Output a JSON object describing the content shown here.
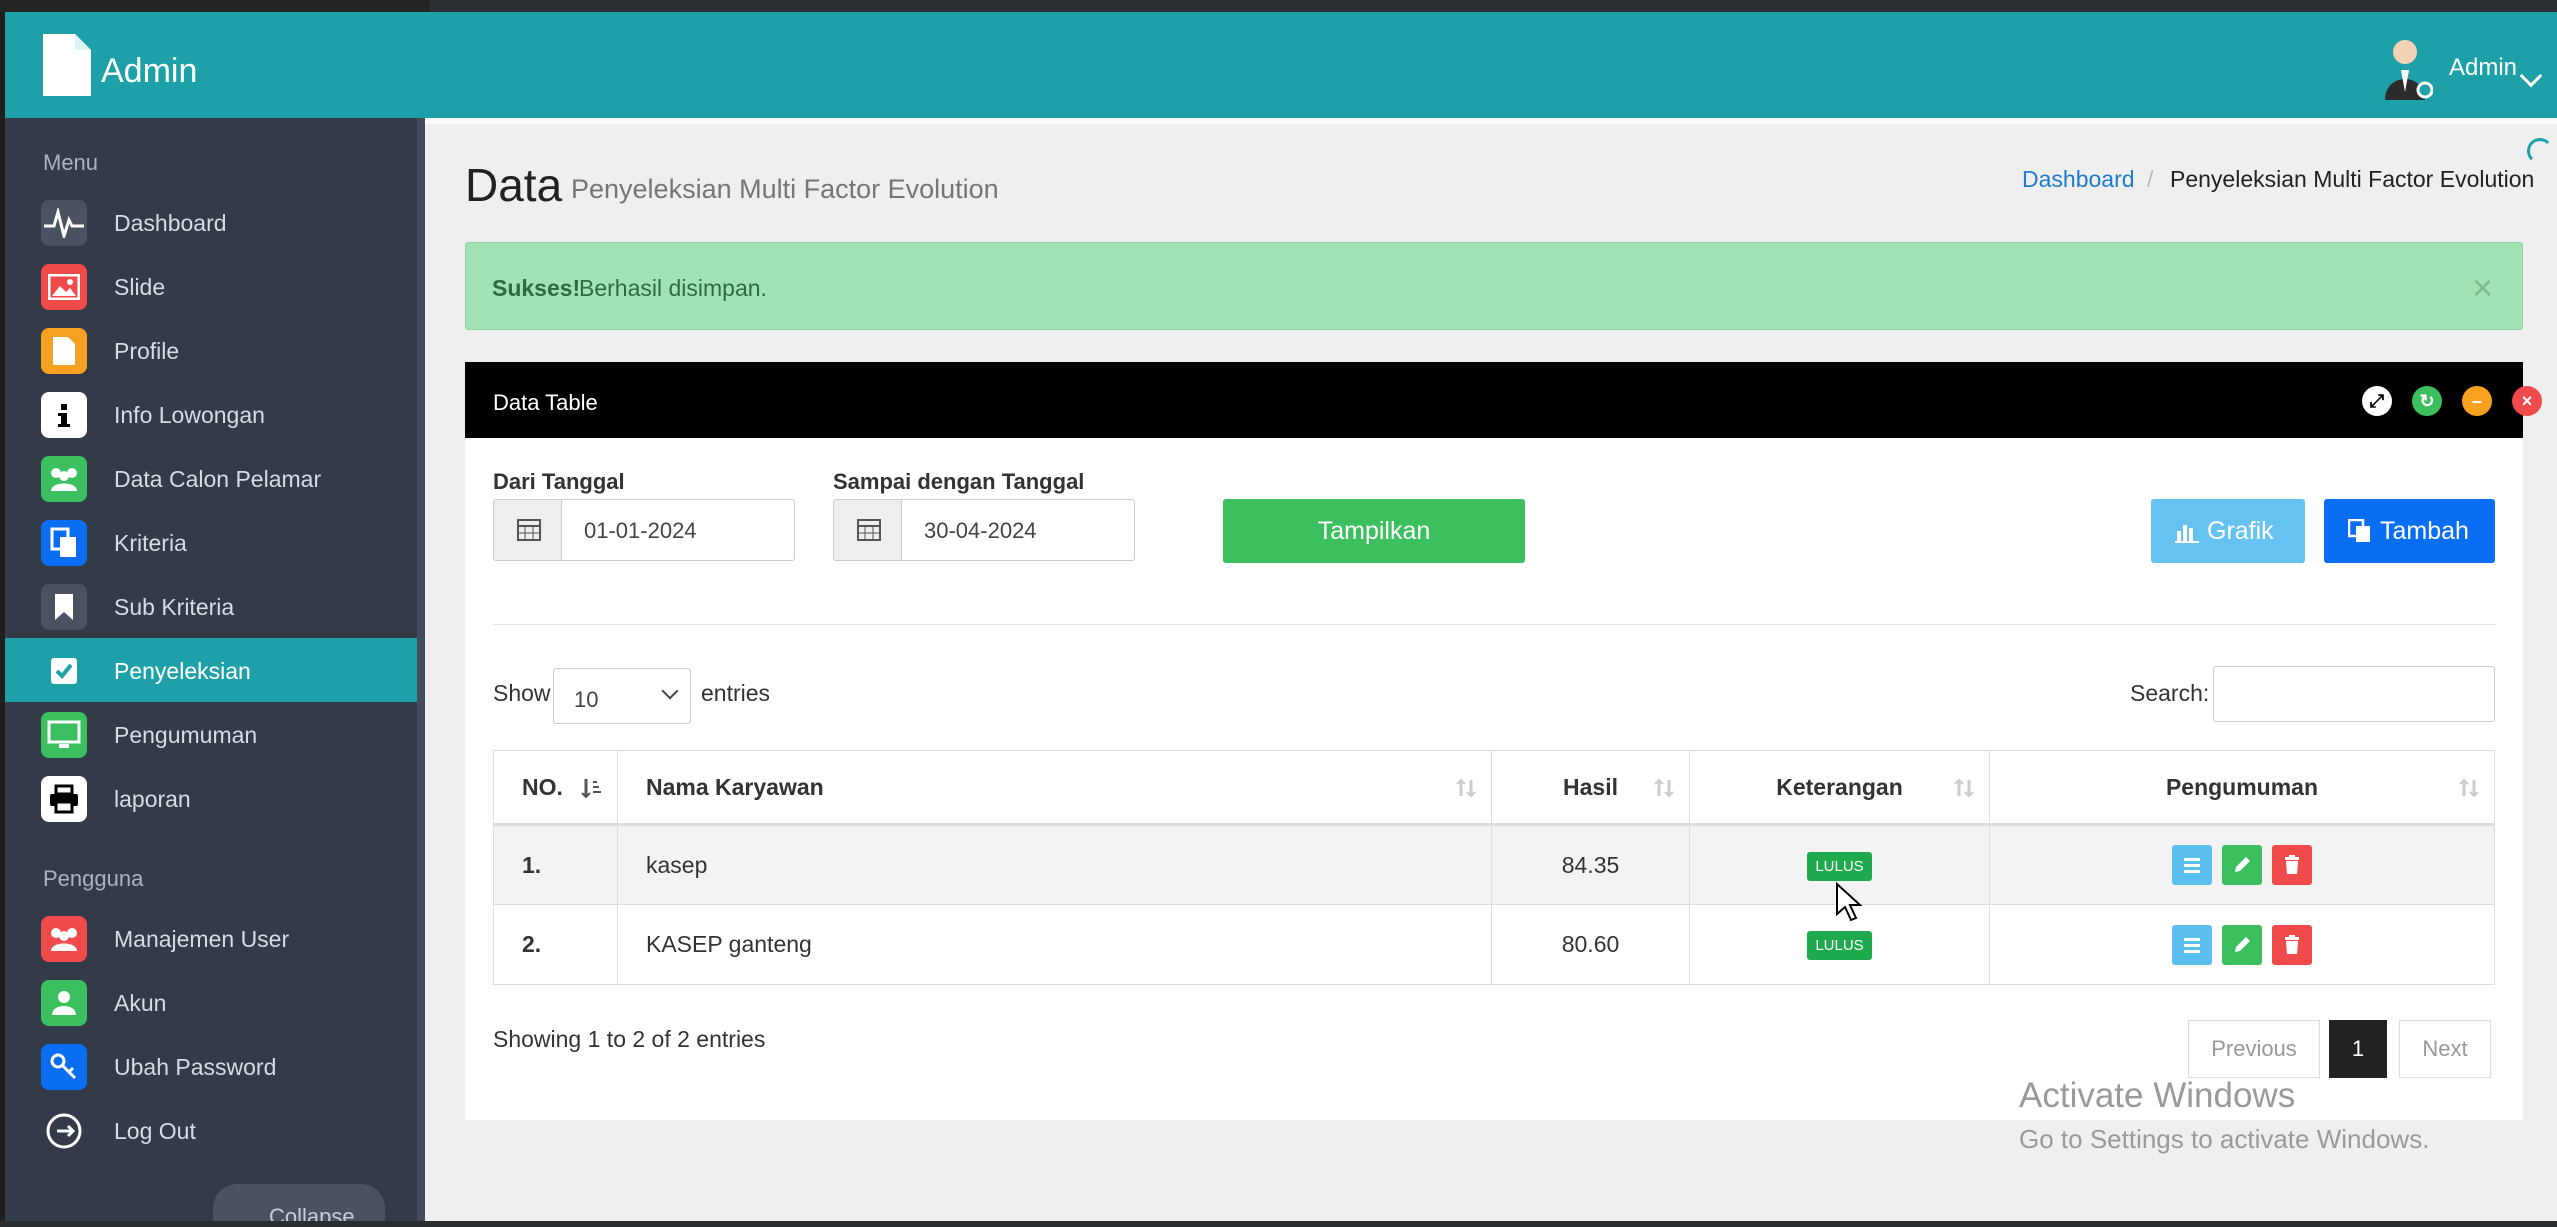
{
  "header": {
    "app_title": "Admin",
    "user_name": "Admin"
  },
  "sidebar": {
    "menu_heading": "Menu",
    "items": [
      {
        "label": "Dashboard",
        "icon": "pulse-icon"
      },
      {
        "label": "Slide",
        "icon": "image-icon"
      },
      {
        "label": "Profile",
        "icon": "document-icon"
      },
      {
        "label": "Info Lowongan",
        "icon": "info-icon"
      },
      {
        "label": "Data Calon Pelamar",
        "icon": "users-icon"
      },
      {
        "label": "Kriteria",
        "icon": "copy-icon"
      },
      {
        "label": "Sub Kriteria",
        "icon": "bookmark-icon"
      },
      {
        "label": "Penyeleksian",
        "icon": "checkbox-icon"
      },
      {
        "label": "Pengumuman",
        "icon": "monitor-icon"
      },
      {
        "label": "laporan",
        "icon": "printer-icon"
      }
    ],
    "pengguna_heading": "Pengguna",
    "user_items": [
      {
        "label": "Manajemen User",
        "icon": "users-icon"
      },
      {
        "label": "Akun",
        "icon": "user-icon"
      },
      {
        "label": "Ubah Password",
        "icon": "key-icon"
      },
      {
        "label": "Log Out",
        "icon": "logout-icon"
      }
    ],
    "collapse_label": "Collapse"
  },
  "page": {
    "title": "Data",
    "subtitle": "Penyeleksian Multi Factor Evolution",
    "breadcrumb": {
      "home": "Dashboard",
      "separator": "/",
      "current": "Penyeleksian Multi Factor Evolution"
    }
  },
  "alert": {
    "strong": "Sukses!",
    "message": "Berhasil disimpan.",
    "close": "×"
  },
  "panel": {
    "title": "Data Table",
    "filter": {
      "from_label": "Dari Tanggal",
      "from_value": "01-01-2024",
      "to_label": "Sampai dengan Tanggal",
      "to_value": "30-04-2024",
      "show_button": "Tampilkan"
    },
    "grafik_button": "Grafik",
    "tambah_button": "Tambah"
  },
  "table": {
    "show_label": "Show",
    "entries_value": "10",
    "entries_label": "entries",
    "search_label": "Search:",
    "columns": [
      "NO.",
      "Nama Karyawan",
      "Hasil",
      "Keterangan",
      "Pengumuman"
    ],
    "rows": [
      {
        "no": "1.",
        "nama": "kasep",
        "hasil": "84.35",
        "keterangan": "LULUS"
      },
      {
        "no": "2.",
        "nama": "KASEP ganteng",
        "hasil": "80.60",
        "keterangan": "LULUS"
      }
    ],
    "info": "Showing 1 to 2 of 2 entries",
    "pagination": {
      "previous": "Previous",
      "current": "1",
      "next": "Next"
    }
  },
  "watermark": {
    "line1": "Activate Windows",
    "line2": "Go to Settings to activate Windows."
  },
  "colors": {
    "header": "#1ea0a8",
    "sidebar": "#333a48",
    "active": "#1ea0a8",
    "success": "#3cbf5e",
    "primary": "#0a6ef5",
    "info": "#66c2f0",
    "danger": "#f04a4a"
  }
}
